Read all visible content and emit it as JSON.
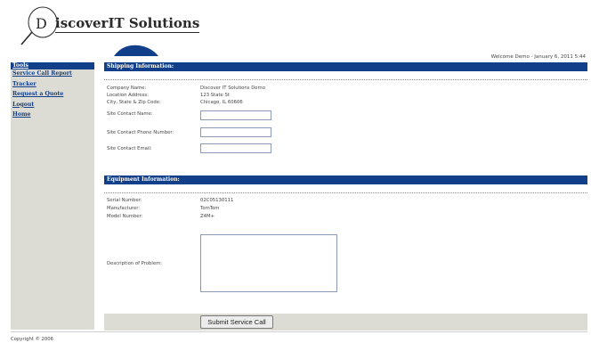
{
  "logo": {
    "text": "iscoverIT Solutions"
  },
  "header": {
    "welcome": "Welcome Demo - January 6, 2011 5:44"
  },
  "sidebar": {
    "items": [
      {
        "label": "Tools"
      },
      {
        "label": "Service Call Report"
      },
      {
        "label": "Tracker"
      },
      {
        "label": "Request a Quote"
      },
      {
        "label": "Logout"
      },
      {
        "label": "Home"
      }
    ]
  },
  "shipping": {
    "title": "Shipping Information:",
    "company_label": "Company Name:",
    "company_value": "Discover IT Solutions Demo",
    "address_label": "Location Address:",
    "address_value": "123 State St",
    "city_label": "City, State & Zip Code:",
    "city_value": "Chicago, IL 60606",
    "contact_name_label": "Site Contact Name:",
    "contact_name_value": "",
    "contact_phone_label": "Site Contact Phone Number:",
    "contact_phone_value": "",
    "contact_email_label": "Site Contact Email:",
    "contact_email_value": ""
  },
  "equipment": {
    "title": "Equipment Information:",
    "serial_label": "Serial Number:",
    "serial_value": "02C05130111",
    "manufacturer_label": "Manufacturer:",
    "manufacturer_value": "TomTom",
    "model_label": "Model Number:",
    "model_value": "Z4M+",
    "problem_label": "Description of Problem:",
    "problem_value": ""
  },
  "actions": {
    "submit_label": "Submit Service Call"
  },
  "footer": {
    "copyright": "Copyright © 2006"
  },
  "colors": {
    "nav_blue": "#123f8a",
    "sidebar_bg": "#dcdcd4",
    "page_bg": "#ffffff"
  }
}
